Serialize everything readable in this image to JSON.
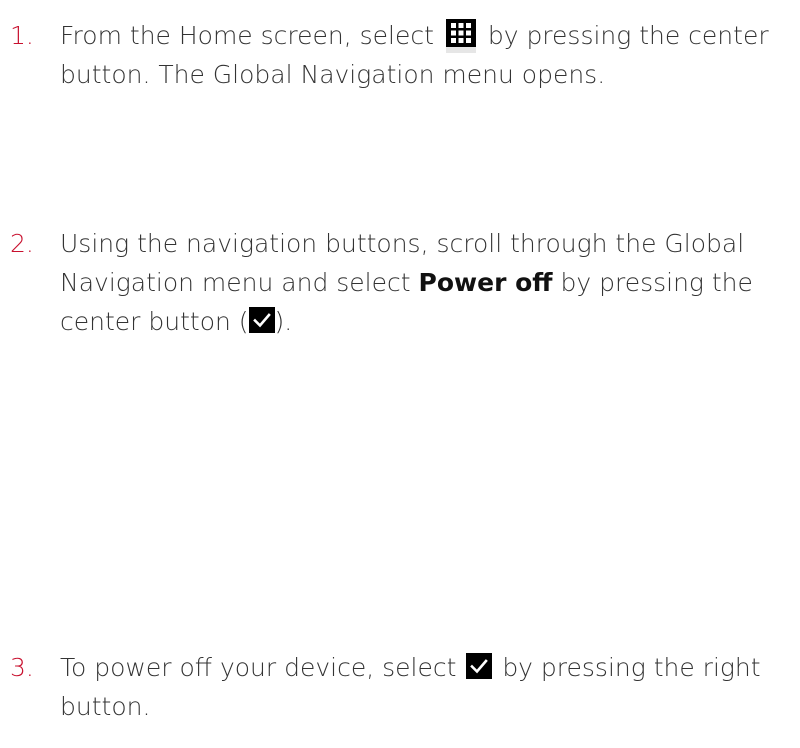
{
  "steps": [
    {
      "number": "1.",
      "before_icon": "From the Home screen, select",
      "icon": "grid-icon",
      "after_icon_line1": "by pressing the center",
      "line2": "button. The Global Navigation menu opens."
    },
    {
      "number": "2.",
      "line1": "Using the navigation buttons, scroll through the Global",
      "line2_before": "Navigation menu and select",
      "line2_strong": "Power off",
      "line2_after": "by pressing the",
      "line3_before": "center button (",
      "icon": "checkmark-icon",
      "line3_after": ")."
    },
    {
      "number": "3.",
      "before_icon": "To power off your device, select",
      "icon": "checkmark-icon",
      "after_icon_line1": "by pressing the right",
      "line2": "button."
    }
  ],
  "colors": {
    "step_number": "#c8102e",
    "text": "#333333",
    "icon_bg": "#000000"
  }
}
